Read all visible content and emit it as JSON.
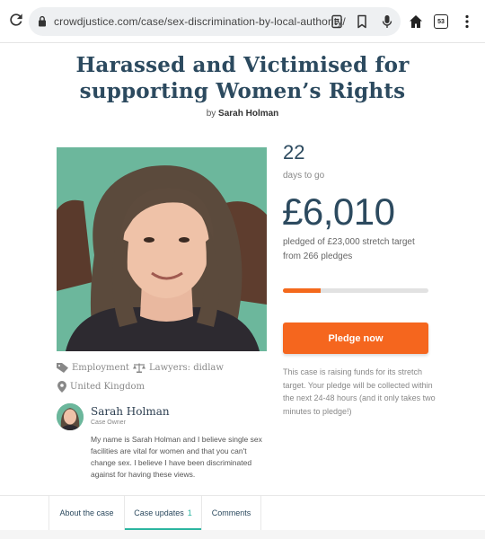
{
  "browser": {
    "url": "crowdjustice.com/case/sex-discrimination-by-local-authority/",
    "tab_count": "53"
  },
  "campaign": {
    "title_line1": "Harassed and Victimised for",
    "title_line2": "supporting Women’s Rights",
    "by_prefix": "by",
    "author": "Sarah Holman"
  },
  "meta": {
    "category": "Employment",
    "lawyers": "Lawyers: didlaw",
    "location": "United Kingdom"
  },
  "owner": {
    "name": "Sarah Holman",
    "role": "Case Owner",
    "description": "My name is Sarah Holman and I believe single sex facilities are vital for women and that you can't change sex. I believe I have been discriminated against for having these views."
  },
  "stats": {
    "days": "22",
    "days_label": "days to go",
    "amount": "£6,010",
    "pledged_line1": "pledged of £23,000 stretch target",
    "pledged_line2": "from 266 pledges",
    "progress_fraction": 0.26
  },
  "pledge": {
    "button_label": "Pledge now",
    "note": "This case is raising funds for its stretch target. Your pledge will be collected within the next 24-48 hours (and it only takes two minutes to pledge!)"
  },
  "tabs": [
    {
      "label": "About the case",
      "count": ""
    },
    {
      "label": "Case updates",
      "count": "1"
    },
    {
      "label": "Comments",
      "count": ""
    }
  ],
  "colors": {
    "accent_orange": "#f5661e",
    "teal": "#2bb5a0",
    "heading": "#2c4a5f"
  }
}
